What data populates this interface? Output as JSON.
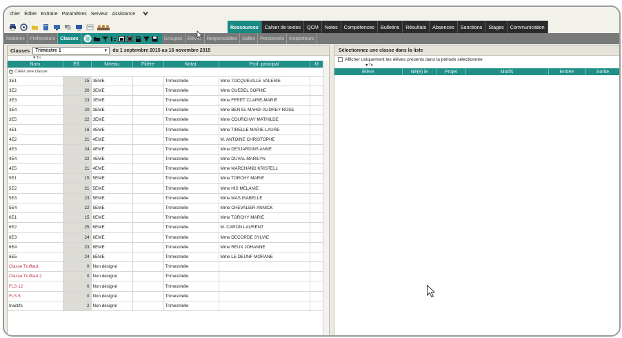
{
  "menu": [
    "chier",
    "Éditer",
    "Extraire",
    "Paramètres",
    "Serveur",
    "Assistance"
  ],
  "topnav": [
    "Ressources",
    "Cahier de textes",
    "QCM",
    "Notes",
    "Compétences",
    "Bulletins",
    "Résultats",
    "Absences",
    "Sanctions",
    "Stages",
    "Communication"
  ],
  "secnav_left": [
    "Matières",
    "Professeurs",
    "Classes"
  ],
  "secnav_right": [
    "Groupes",
    "Élèves",
    "Responsables",
    "Salles",
    "Personnels",
    "Inspecteurs"
  ],
  "left": {
    "label": "Classes",
    "period": "Trimestre 1",
    "range": "du 1 septembre 2015 au 16 novembre 2015",
    "sort_label": "Tri",
    "columns": [
      "Nom",
      "Eff.",
      "Niveau",
      "Filière",
      "Notat.",
      "Prof. principal",
      "M"
    ],
    "create_label": "Créer une classe",
    "rows": [
      {
        "nom": "3E1",
        "eff": "15",
        "niveau": "3EME",
        "filiere": "",
        "notat": "Trimestrielle",
        "prof": "Mme TOCQUEVILLE VALERIE",
        "red": false
      },
      {
        "nom": "3E2",
        "eff": "20",
        "niveau": "3EME",
        "filiere": "",
        "notat": "Trimestrielle",
        "prof": "Mme GUEBEL SOPHIE",
        "red": false
      },
      {
        "nom": "3E3",
        "eff": "23",
        "niveau": "3EME",
        "filiere": "",
        "notat": "Trimestrielle",
        "prof": "Mme FERET CLAIRE-MARIE",
        "red": false
      },
      {
        "nom": "3E4",
        "eff": "20",
        "niveau": "3EME",
        "filiere": "",
        "notat": "Trimestrielle",
        "prof": "Mme BEN EL MAHDI AUDREY ROSE",
        "red": false
      },
      {
        "nom": "3E5",
        "eff": "22",
        "niveau": "3EME",
        "filiere": "",
        "notat": "Trimestrielle",
        "prof": "Mme COURCHAY MATHILDE",
        "red": false
      },
      {
        "nom": "4E1",
        "eff": "16",
        "niveau": "4EME",
        "filiere": "",
        "notat": "Trimestrielle",
        "prof": "Mme TIRELLE MARIE-LAURE",
        "red": false
      },
      {
        "nom": "4E2",
        "eff": "21",
        "niveau": "4EME",
        "filiere": "",
        "notat": "Trimestrielle",
        "prof": "M. ANTOINE CHRISTOPHE",
        "red": false
      },
      {
        "nom": "4E3",
        "eff": "24",
        "niveau": "4EME",
        "filiere": "",
        "notat": "Trimestrielle",
        "prof": "Mme DESJARDINS ANNE",
        "red": false
      },
      {
        "nom": "4E4",
        "eff": "22",
        "niveau": "4EME",
        "filiere": "",
        "notat": "Trimestrielle",
        "prof": "Mme DUVAL MARILYN",
        "red": false
      },
      {
        "nom": "4E5",
        "eff": "21",
        "niveau": "4EME",
        "filiere": "",
        "notat": "Trimestrielle",
        "prof": "Mme MARCHAND KRISTELL",
        "red": false
      },
      {
        "nom": "5E1",
        "eff": "15",
        "niveau": "5EME",
        "filiere": "",
        "notat": "Trimestrielle",
        "prof": "Mme TORCHY MARIE",
        "red": false
      },
      {
        "nom": "5E2",
        "eff": "21",
        "niveau": "5EME",
        "filiere": "",
        "notat": "Trimestrielle",
        "prof": "Mme HIS MELANIE",
        "red": false
      },
      {
        "nom": "5E3",
        "eff": "23",
        "niveau": "5EME",
        "filiere": "",
        "notat": "Trimestrielle",
        "prof": "Mme MAS ISABELLE",
        "red": false
      },
      {
        "nom": "5E4",
        "eff": "22",
        "niveau": "5EME",
        "filiere": "",
        "notat": "Trimestrielle",
        "prof": "Mme CHEVALIER ANNICK",
        "red": false
      },
      {
        "nom": "6E1",
        "eff": "15",
        "niveau": "6EME",
        "filiere": "",
        "notat": "Trimestrielle",
        "prof": "Mme TORCHY MARIE",
        "red": false
      },
      {
        "nom": "6E2",
        "eff": "25",
        "niveau": "6EME",
        "filiere": "",
        "notat": "Trimestrielle",
        "prof": "M. CARON LAURENT",
        "red": false
      },
      {
        "nom": "6E3",
        "eff": "24",
        "niveau": "6EME",
        "filiere": "",
        "notat": "Trimestrielle",
        "prof": "Mme DECORDE SYLVIE",
        "red": false
      },
      {
        "nom": "6E4",
        "eff": "23",
        "niveau": "6EME",
        "filiere": "",
        "notat": "Trimestrielle",
        "prof": "Mme REUX JOHANNE",
        "red": false
      },
      {
        "nom": "6E5",
        "eff": "24",
        "niveau": "6EME",
        "filiere": "",
        "notat": "Trimestrielle",
        "prof": "Mme LE DEUNF MORANE",
        "red": false
      },
      {
        "nom": "Classe Truffaut",
        "eff": "0",
        "niveau": "Non désigné",
        "filiere": "",
        "notat": "Trimestrielle",
        "prof": "",
        "red": true
      },
      {
        "nom": "Classe Truffaut 2",
        "eff": "0",
        "niveau": "Non désigné",
        "filiere": "",
        "notat": "Trimestrielle",
        "prof": "",
        "red": true
      },
      {
        "nom": "FLS 12",
        "eff": "0",
        "niveau": "Non désigné",
        "filiere": "",
        "notat": "Trimestrielle",
        "prof": "",
        "red": true
      },
      {
        "nom": "FLS 6",
        "eff": "0",
        "niveau": "Non désigné",
        "filiere": "",
        "notat": "Trimestrielle",
        "prof": "",
        "red": true
      },
      {
        "nom": "Inactifs",
        "eff": "2",
        "niveau": "Non désigné",
        "filiere": "",
        "notat": "Trimestrielle",
        "prof": "",
        "red": false
      }
    ]
  },
  "right": {
    "title": "Sélectionnez une classe dans la liste",
    "option_label": "Afficher uniquement les élèves présents dans la période sélectionnée",
    "sort_label": "Tri",
    "columns": [
      "Élève",
      "Né(e) le",
      "Projet",
      "Motifs",
      "Entrée",
      "Sortie"
    ]
  },
  "colors": {
    "accent": "#1f8f88",
    "dark_nav": "#2b2b2b",
    "red_text": "#c0304a"
  }
}
